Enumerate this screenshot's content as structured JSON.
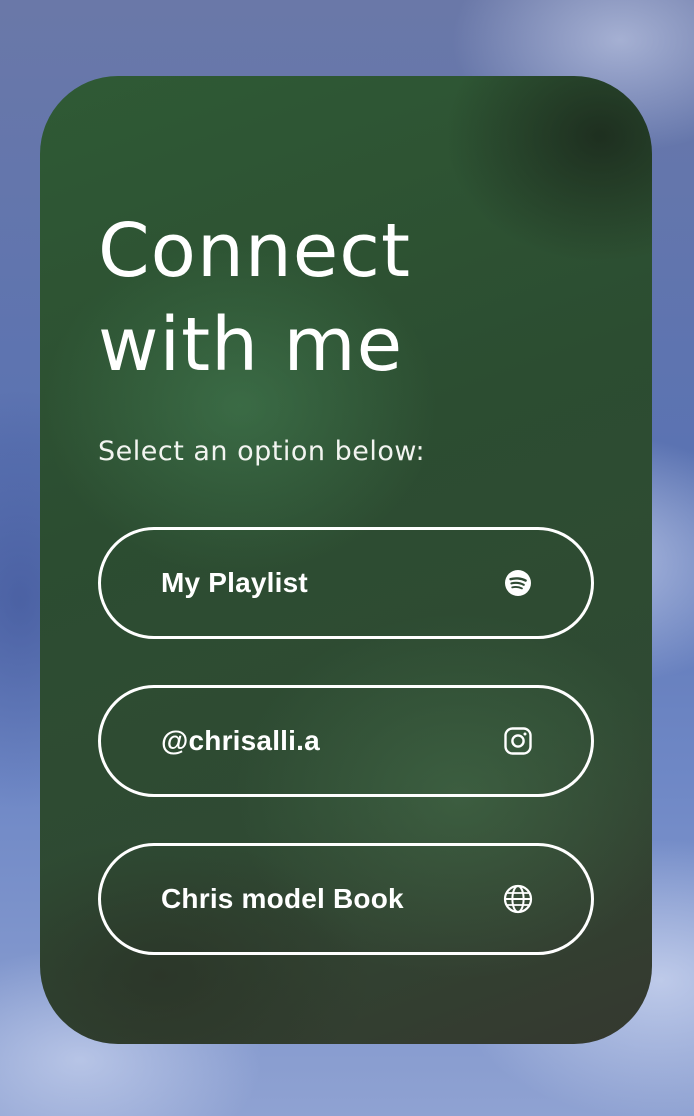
{
  "card": {
    "title_line1": "Connect",
    "title_line2": "with me",
    "subtitle": "Select an option below:"
  },
  "links": [
    {
      "label": "My Playlist",
      "icon": "spotify-icon"
    },
    {
      "label": "@chrisalli.a",
      "icon": "instagram-icon"
    },
    {
      "label": "Chris model Book",
      "icon": "globe-icon"
    }
  ],
  "colors": {
    "card_green": "#2f5a35",
    "sky_blue": "#5b73b2",
    "text": "#ffffff"
  }
}
